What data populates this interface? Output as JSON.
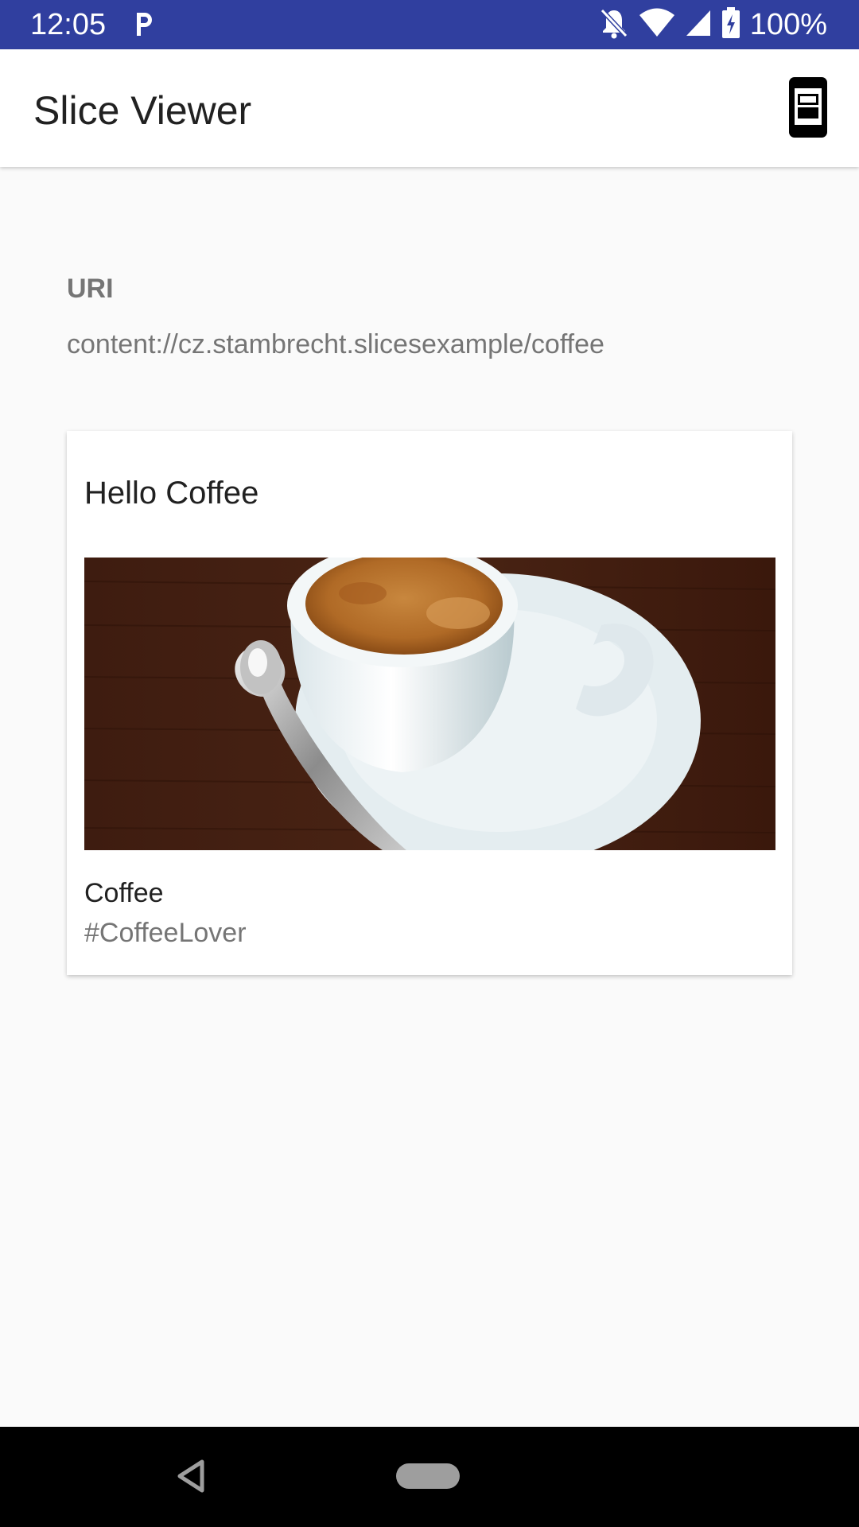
{
  "status_bar": {
    "time": "12:05",
    "battery": "100%",
    "icons": [
      "parking-icon",
      "notifications-off-icon",
      "wifi-icon",
      "cell-signal-icon",
      "battery-charging-icon"
    ]
  },
  "app_bar": {
    "title": "Slice Viewer",
    "action_icon": "view-mode-icon"
  },
  "uri": {
    "label": "URI",
    "value": "content://cz.stambrecht.slicesexample/coffee"
  },
  "slice": {
    "title": "Hello Coffee",
    "image": "coffee-cup-image",
    "item_title": "Coffee",
    "item_subtitle": "#CoffeeLover"
  },
  "nav_bar": {
    "icons": [
      "back-icon",
      "home-pill-icon"
    ]
  },
  "colors": {
    "status_bar": "#303f9f",
    "app_bar": "#ffffff",
    "background": "#fafafa",
    "nav_bar": "#000000"
  }
}
